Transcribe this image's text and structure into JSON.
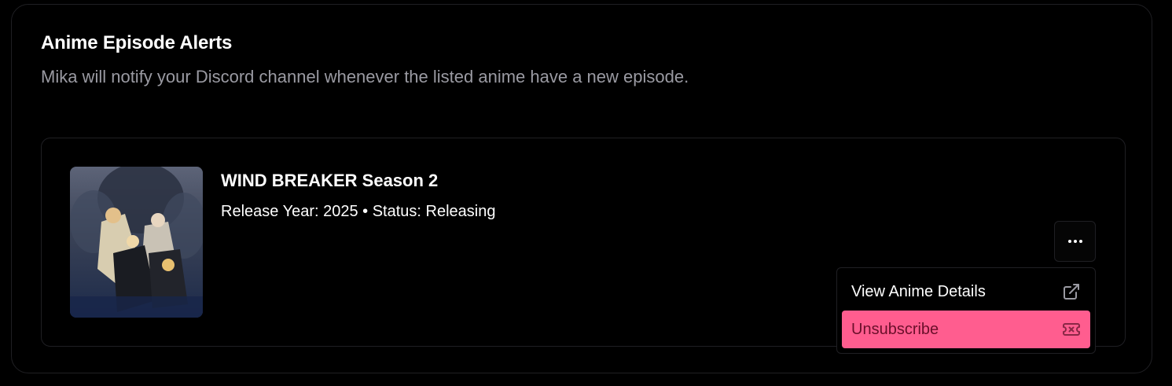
{
  "panel": {
    "title": "Anime Episode Alerts",
    "subtitle": "Mika will notify your Discord channel whenever the listed anime have a new episode."
  },
  "subscriptions": [
    {
      "title": "WIND BREAKER Season 2",
      "meta": "Release Year: 2025 • Status: Releasing",
      "cover_icon": "anime-cover-image"
    }
  ],
  "actions_menu": {
    "trigger_icon": "ellipsis-icon",
    "items": [
      {
        "label": "View Anime Details",
        "icon": "external-link-icon"
      },
      {
        "label": "Unsubscribe",
        "icon": "ticket-x-icon"
      }
    ]
  },
  "colors": {
    "background": "#000000",
    "border": "#1f1f23",
    "muted_text": "#9a9aa2",
    "danger_accent": "#ff5d8f",
    "danger_text": "#6a0f2a"
  }
}
